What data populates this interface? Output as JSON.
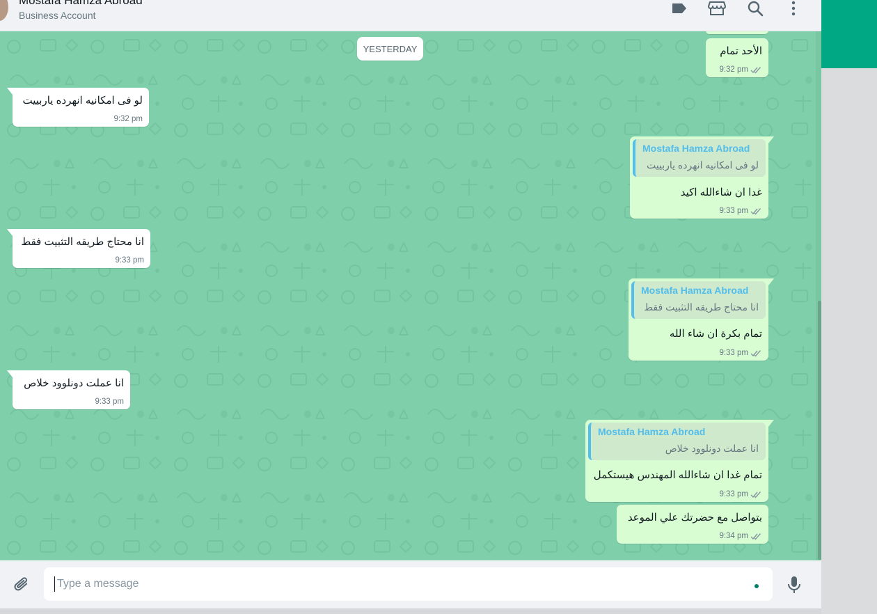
{
  "contact": {
    "name": "Mostafa Hamza Abroad",
    "subtitle": "Business Account"
  },
  "date_chip": "YESTERDAY",
  "messages": [
    {
      "dir": "out",
      "text": "الأحد تمام",
      "time": "9:32 pm",
      "status": "read"
    },
    {
      "dir": "in",
      "text": "لو فى امكانيه انهرده ياربييت",
      "time": "9:32 pm"
    },
    {
      "dir": "out",
      "quote_name": "Mostafa Hamza Abroad",
      "quote_text": "لو فى امكانيه انهرده ياربييت",
      "text": "غدا ان شاءالله اكيد",
      "time": "9:33 pm",
      "status": "read"
    },
    {
      "dir": "in",
      "text": "انا محتاج طريقه التثبيت فقط",
      "time": "9:33 pm"
    },
    {
      "dir": "out",
      "quote_name": "Mostafa Hamza Abroad",
      "quote_text": "انا محتاج طريقه التثبيت فقط",
      "text": "تمام بكرة ان شاء الله",
      "time": "9:33 pm",
      "status": "read"
    },
    {
      "dir": "in",
      "text": "انا عملت دونلوود خلاص",
      "time": "9:33 pm"
    },
    {
      "dir": "out",
      "quote_name": "Mostafa Hamza Abroad",
      "quote_text": "انا عملت دونلوود خلاص",
      "text": "تمام غدا ان شاءالله المهندس هيستكمل",
      "time": "9:33 pm",
      "status": "read"
    },
    {
      "dir": "out",
      "text": "بتواصل مع حضرتك علي الموعد",
      "time": "9:34 pm",
      "status": "read"
    }
  ],
  "composer": {
    "placeholder": "Type a message"
  },
  "icons": {
    "header": [
      "label-icon",
      "catalog-icon",
      "search-icon",
      "menu-icon"
    ],
    "composer": [
      "attach-icon",
      "mic-icon"
    ]
  },
  "colors": {
    "accent": "#00a884",
    "chat_bg": "#80cfab",
    "incoming": "#ffffff",
    "outgoing": "#d9fdd3",
    "quote_bar": "#53bdeb",
    "read_ticks": "#8696a0"
  }
}
